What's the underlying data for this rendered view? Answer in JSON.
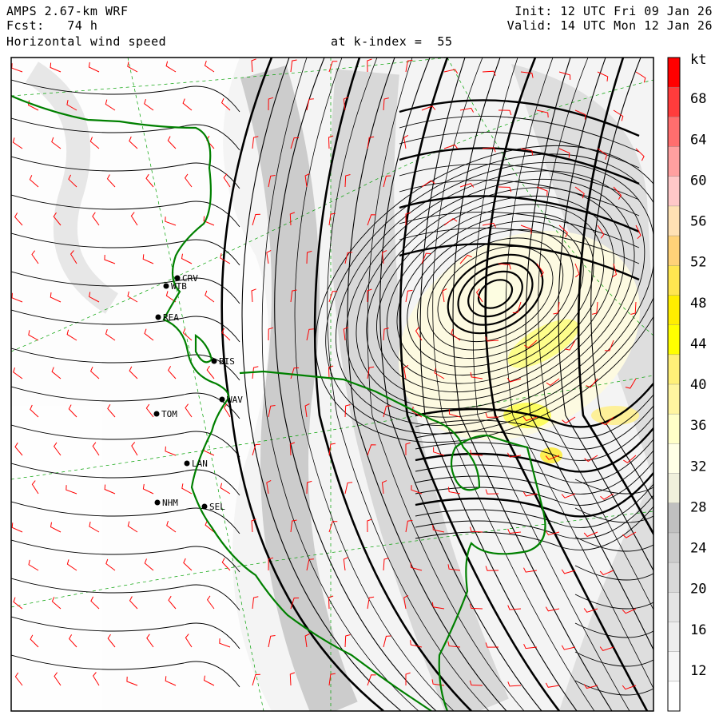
{
  "header": {
    "model": "AMPS 2.67-km WRF",
    "forecast": "Fcst:   74 h",
    "field": "Horizontal wind speed",
    "level": "at k-index =  55",
    "init": "Init: 12 UTC Fri 09 Jan 26",
    "valid": "Valid: 14 UTC Mon 12 Jan 26"
  },
  "colorbar": {
    "unit": "kt",
    "labels": [
      "68",
      "64",
      "60",
      "56",
      "52",
      "48",
      "44",
      "40",
      "36",
      "32",
      "28",
      "24",
      "20",
      "16",
      "12"
    ],
    "colors": [
      "#ff0000",
      "#ff3c3c",
      "#ff6e6e",
      "#ffa0a0",
      "#ffc8c8",
      "#ffe1b4",
      "#ffd278",
      "#ffe650",
      "#ffee00",
      "#ffff00",
      "#fff078",
      "#fff5a0",
      "#ffffc8",
      "#ffffe6",
      "#f0f0dc",
      "#c0c0c0",
      "#cccccc",
      "#d8d8d8",
      "#e4e4e4",
      "#eeeeee",
      "#f6f6f6",
      "#ffffff"
    ]
  },
  "stations": [
    {
      "code": "CRV"
    },
    {
      "code": "WTB"
    },
    {
      "code": "REA"
    },
    {
      "code": "BIS"
    },
    {
      "code": "WAV"
    },
    {
      "code": "TOM"
    },
    {
      "code": "LAN"
    },
    {
      "code": "NHM"
    },
    {
      "code": "SEL"
    }
  ],
  "colors": {
    "coast": "#008000",
    "barbs": "#ff0000",
    "streamlines": "#000000",
    "grid": "#00a000"
  }
}
